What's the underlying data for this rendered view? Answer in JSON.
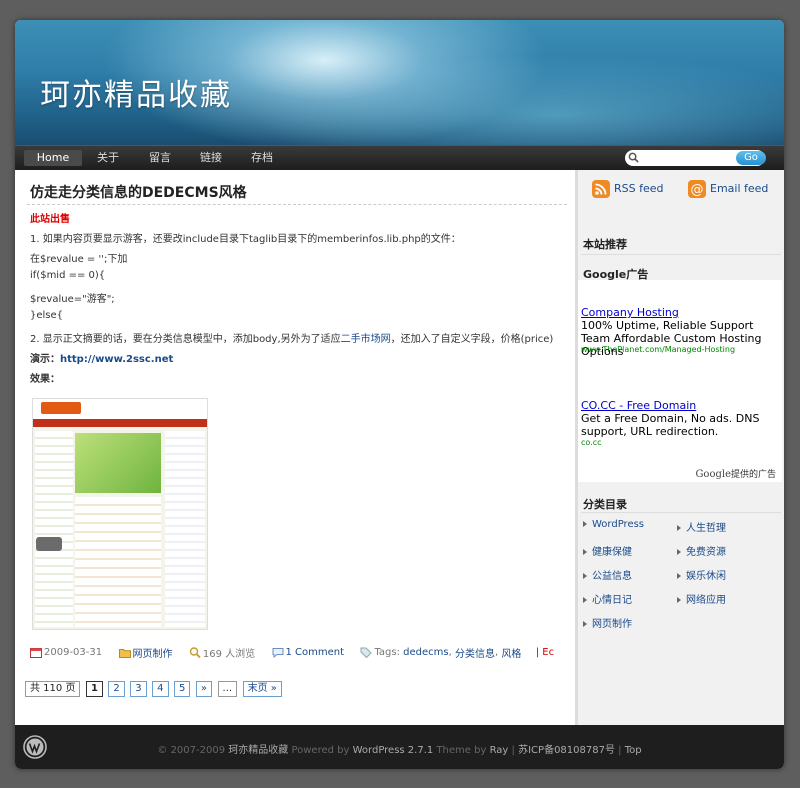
{
  "header": {
    "site_title": "珂亦精品收藏"
  },
  "nav": {
    "items": [
      {
        "label": "Home",
        "active": true
      },
      {
        "label": "关于"
      },
      {
        "label": "留言"
      },
      {
        "label": "链接"
      },
      {
        "label": "存档"
      }
    ],
    "search": {
      "value": "",
      "button_label": "Go"
    }
  },
  "post": {
    "title": "仿走走分类信息的DEDECMS风格",
    "red_tag": "此站出售",
    "lines": [
      "1. 如果内容页要显示游客，还要改include目录下taglib目录下的memberinfos.lib.php的文件：",
      "在$revalue = '';下加",
      "if($mid == 0){",
      "$revalue=\"游客\";",
      "}else{"
    ],
    "line6_pre": "2. 显示正文摘要的话，要在分类信息模型中，添加body,另外为了适应",
    "line6_link": "二手市场网",
    "line6_post": "，还加入了自定义字段，价格(price)",
    "demo_label": "演示：",
    "demo_link": "http://www.2ssc.net",
    "effect_label": "效果：",
    "meta": {
      "date": "2009-03-31",
      "category": "网页制作",
      "views": "169 人浏览",
      "comments": "1 Comment",
      "tags_label": "Tags:",
      "tag1": "dedecms",
      "tag2": "分类信息",
      "tag3": "风格",
      "edit": "Ec"
    }
  },
  "pager": {
    "total": "共 110 页",
    "current": "1",
    "pages": [
      "2",
      "3",
      "4",
      "5"
    ],
    "next": "»",
    "ellipsis": "...",
    "last": "末页 »"
  },
  "sidebar": {
    "rss_label": "RSS feed",
    "email_label": "Email feed",
    "recommend_heading": "本站推荐",
    "google_heading": "Google广告",
    "ads": [
      {
        "title": "Company Hosting",
        "text": "100% Uptime, Reliable Support Team Affordable Custom Hosting Options",
        "url": "www.ThePlanet.com/Managed-Hosting"
      },
      {
        "title": "CO.CC - Free Domain",
        "text": "Get a Free Domain, No ads. DNS support, URL redirection.",
        "url": "co.cc"
      }
    ],
    "ads_by_brand": "Google",
    "ads_by_suffix": "提供的广告",
    "categories_heading": "分类目录",
    "categories": [
      "WordPress",
      "人生哲理",
      "健康保健",
      "免费资源",
      "公益信息",
      "娱乐休闲",
      "心情日记",
      "网络应用",
      "网页制作"
    ]
  },
  "footer": {
    "copyright": "© 2007-2009",
    "site_link": "珂亦精品收藏",
    "powered_by": "Powered by",
    "wp_link": "WordPress 2.7.1",
    "theme_by": "Theme by",
    "author": "Ray",
    "sep1": "|",
    "icp": "苏ICP备08108787号",
    "sep2": "|",
    "top": "Top"
  },
  "colors": {
    "accent": "#2a8fce",
    "link": "#1a4a8a",
    "alert": "#e00000",
    "footer_bg": "#1e1e1e"
  }
}
